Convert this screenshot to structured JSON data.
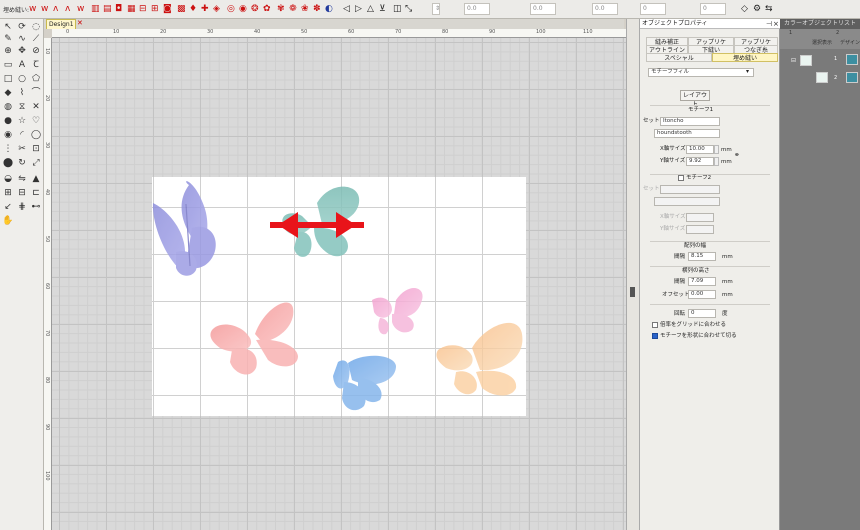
{
  "toolbar": {
    "label": "埋め縫い:",
    "zoom_value": "0.0",
    "offset_value": "0.0",
    "angle_value": "0.0",
    "icons": [
      "zigzag-stitch-icon",
      "fill-stitch-icon",
      "pattern-icon",
      "color-icon",
      "align-icon",
      "distribute-icon",
      "rotate-icon"
    ]
  },
  "document": {
    "tab_label": "Design1",
    "close_label": "✕",
    "ruler_top": [
      "0",
      "10",
      "20",
      "30",
      "40",
      "50",
      "60",
      "70",
      "80",
      "90",
      "100",
      "110",
      "120"
    ],
    "ruler_left": [
      "10",
      "20",
      "30",
      "40",
      "50",
      "60",
      "70",
      "80",
      "90",
      "100"
    ]
  },
  "properties": {
    "title": "オブジェクトプロパティ",
    "tabs_row1": [
      "縫み補正",
      "アップリケ",
      "アップリケ"
    ],
    "tabs_row2": [
      "アウトライン",
      "下縫い",
      "つなぎ糸"
    ],
    "tabs_row3": [
      "スペシャル",
      "埋め縫い"
    ],
    "fill_type": "モチーフフィル",
    "layout_button": "レイアウト",
    "motif1_title": "モチーフ1",
    "set_label": "セット",
    "set_value": "Itoncho",
    "pattern_value": "houndstooth",
    "x_size_label": "X軸サイズ",
    "x_size_value": "10.00",
    "y_size_label": "Y軸サイズ",
    "y_size_value": "9.92",
    "unit": "mm",
    "motif2_title": "モチーフ2",
    "set2_label": "セット",
    "x2_size_label": "X軸サイズ",
    "y2_size_label": "Y軸サイズ",
    "row_width_title": "配列の幅",
    "spacing_label": "間隔",
    "spacing_value": "8.15",
    "row_height_title": "横列の高さ",
    "spacing2_label": "間隔",
    "spacing2_value": "7.09",
    "offset_label": "オフセット",
    "offset_value": "0.00",
    "rotation_label": "回転",
    "rotation_value": "0",
    "rotation_unit": "度",
    "fit_grid_label": "倍率をグリッドに合わせる",
    "fit_shape_label": "モチーフを形状に合わせて切る",
    "fit_grid_checked": false,
    "fit_shape_checked": true
  },
  "color_list": {
    "title": "カラーオブジェクトリスト",
    "col_headers": [
      "選択表示",
      "デザイン"
    ],
    "group_index": [
      "1",
      "2"
    ],
    "rows": [
      {
        "index": "1"
      },
      {
        "index": "2"
      }
    ]
  },
  "colors": {
    "butterfly_purple": "#8e8fdc",
    "butterfly_teal": "#7bbcb4",
    "butterfly_pink": "#f7a4a4",
    "butterfly_lightpink": "#f3a9d3",
    "butterfly_blue": "#7fb1ea",
    "butterfly_peach": "#f9c994",
    "arrow_red": "#e8141a"
  }
}
